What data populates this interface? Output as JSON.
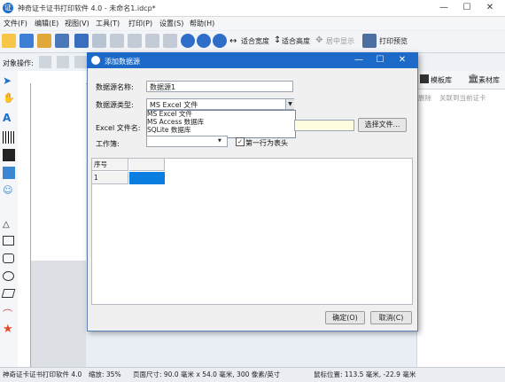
{
  "app": {
    "title": "神奇证卡证书打印软件 4.0 - 未命名1.idcp*",
    "window_controls": [
      "—",
      "☐",
      "✕"
    ]
  },
  "menubar": {
    "items": [
      "文件(F)",
      "编辑(E)",
      "视图(V)",
      "工具(T)",
      "打印(P)",
      "设置(S)",
      "帮助(H)"
    ]
  },
  "toolbar": {
    "fit_width": "适合宽度",
    "fit_height": "适合高度",
    "center_display": "居中显示",
    "print_preview": "打印预览"
  },
  "objrow": {
    "label": "对象操作:"
  },
  "right_panel": {
    "tabs": [
      "模板库",
      "素材库"
    ],
    "row_labels": [
      "删除",
      "关联到当前证卡"
    ]
  },
  "dialog": {
    "title": "添加数据源",
    "name_label": "数据源名称:",
    "name_value": "数据源1",
    "type_label": "数据源类型:",
    "type_value": "MS Excel 文件",
    "type_options": [
      "MS Excel 文件",
      "MS Access 数据库",
      "SQLite 数据库"
    ],
    "file_label": "Excel 文件名:",
    "file_value": "",
    "browse_button": "选择文件...",
    "sheet_label": "工作簿:",
    "sheet_value": "",
    "first_row_header": true,
    "first_row_label": "第一行为表头",
    "grid_header": "序号",
    "grid_row_index": "1",
    "ok_button": "确定(O)",
    "cancel_button": "取消(C)"
  },
  "statusbar": {
    "app": "神奇证卡证书打印软件 4.0",
    "zoom": "缩放: 35%",
    "page_size": "页面尺寸: 90.0 毫米 x 54.0 毫米, 300 像素/英寸",
    "mouse_pos": "鼠标位置: 113.5 毫米,  -22.9 毫米"
  },
  "colors": {
    "accent": "#1c69c7",
    "cell_selected": "#0a7de0"
  }
}
